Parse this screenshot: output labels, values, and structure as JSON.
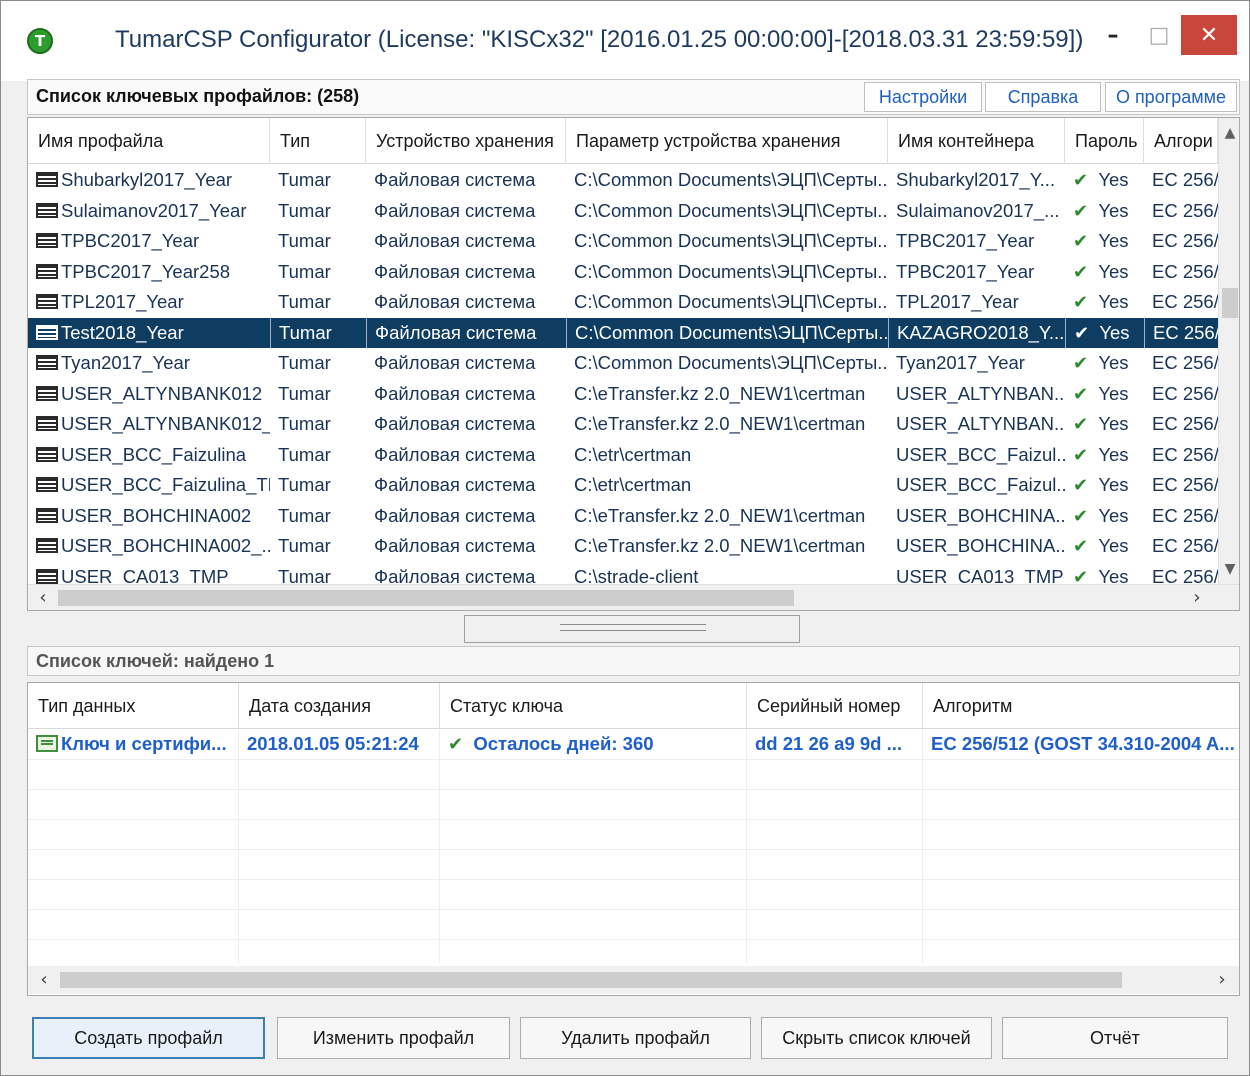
{
  "window": {
    "title": "TumarCSP Configurator (License: \"KISCx32\" [2016.01.25 00:00:00]-[2018.03.31 23:59:59])",
    "app_icon_letter": "T",
    "min_glyph": "–",
    "max_glyph": "□",
    "close_glyph": "✕"
  },
  "profiles": {
    "title": "Список ключевых профайлов: (258)",
    "buttons": {
      "settings": "Настройки",
      "help": "Справка",
      "about": "О программе"
    },
    "columns": [
      "Имя профайла",
      "Тип",
      "Устройство хранения",
      "Параметр устройства хранения",
      "Имя контейнера",
      "Пароль",
      "Алгори"
    ],
    "selected_index": 5,
    "rows": [
      {
        "name": "Shubarkyl2017_Year",
        "type": "Tumar",
        "storage": "Файловая система",
        "param": "C:\\Common Documents\\ЭЦП\\Серты...",
        "container": "Shubarkyl2017_Y...",
        "password": "Yes",
        "algo": "EC 256/"
      },
      {
        "name": "Sulaimanov2017_Year",
        "type": "Tumar",
        "storage": "Файловая система",
        "param": "C:\\Common Documents\\ЭЦП\\Серты...",
        "container": "Sulaimanov2017_...",
        "password": "Yes",
        "algo": "EC 256/"
      },
      {
        "name": "TPBC2017_Year",
        "type": "Tumar",
        "storage": "Файловая система",
        "param": "C:\\Common Documents\\ЭЦП\\Серты...",
        "container": "TPBC2017_Year",
        "password": "Yes",
        "algo": "EC 256/"
      },
      {
        "name": "TPBC2017_Year258",
        "type": "Tumar",
        "storage": "Файловая система",
        "param": "C:\\Common Documents\\ЭЦП\\Серты...",
        "container": "TPBC2017_Year",
        "password": "Yes",
        "algo": "EC 256/"
      },
      {
        "name": "TPL2017_Year",
        "type": "Tumar",
        "storage": "Файловая система",
        "param": "C:\\Common Documents\\ЭЦП\\Серты...",
        "container": "TPL2017_Year",
        "password": "Yes",
        "algo": "EC 256/"
      },
      {
        "name": "Test2018_Year",
        "type": "Tumar",
        "storage": "Файловая система",
        "param": "C:\\Common Documents\\ЭЦП\\Серты...",
        "container": "KAZAGRO2018_Y...",
        "password": "Yes",
        "algo": "EC 256/"
      },
      {
        "name": "Tyan2017_Year",
        "type": "Tumar",
        "storage": "Файловая система",
        "param": "C:\\Common Documents\\ЭЦП\\Серты...",
        "container": "Tyan2017_Year",
        "password": "Yes",
        "algo": "EC 256/"
      },
      {
        "name": "USER_ALTYNBANK012",
        "type": "Tumar",
        "storage": "Файловая система",
        "param": "C:\\eTransfer.kz 2.0_NEW1\\certman",
        "container": "USER_ALTYNBAN...",
        "password": "Yes",
        "algo": "EC 256/"
      },
      {
        "name": "USER_ALTYNBANK012_...",
        "type": "Tumar",
        "storage": "Файловая система",
        "param": "C:\\eTransfer.kz 2.0_NEW1\\certman",
        "container": "USER_ALTYNBAN...",
        "password": "Yes",
        "algo": "EC 256/"
      },
      {
        "name": "USER_BCC_Faizulina",
        "type": "Tumar",
        "storage": "Файловая система",
        "param": "C:\\etr\\certman",
        "container": "USER_BCC_Faizul...",
        "password": "Yes",
        "algo": "EC 256/"
      },
      {
        "name": "USER_BCC_Faizulina_TMP",
        "type": "Tumar",
        "storage": "Файловая система",
        "param": "C:\\etr\\certman",
        "container": "USER_BCC_Faizul...",
        "password": "Yes",
        "algo": "EC 256/"
      },
      {
        "name": "USER_BOHCHINA002",
        "type": "Tumar",
        "storage": "Файловая система",
        "param": "C:\\eTransfer.kz 2.0_NEW1\\certman",
        "container": "USER_BOHCHINA...",
        "password": "Yes",
        "algo": "EC 256/"
      },
      {
        "name": "USER_BOHCHINA002_...",
        "type": "Tumar",
        "storage": "Файловая система",
        "param": "C:\\eTransfer.kz 2.0_NEW1\\certman",
        "container": "USER_BOHCHINA...",
        "password": "Yes",
        "algo": "EC 256/"
      },
      {
        "name": "USER_CA013_TMP",
        "type": "Tumar",
        "storage": "Файловая система",
        "param": "C:\\strade-client",
        "container": "USER_CA013_TMP",
        "password": "Yes",
        "algo": "EC 256/"
      }
    ]
  },
  "keys": {
    "title": "Список ключей: найдено 1",
    "columns": [
      "Тип данных",
      "Дата создания",
      "Статус ключа",
      "Серийный номер",
      "Алгоритм"
    ],
    "rows": [
      {
        "type": "Ключ и сертифи...",
        "date": "2018.01.05 05:21:24",
        "status": "Осталось дней: 360",
        "serial": "dd 21 26 a9 9d ...",
        "algorithm": "EC 256/512 (GOST 34.310-2004 A..."
      }
    ]
  },
  "actions": {
    "create": "Создать профайл",
    "edit": "Изменить профайл",
    "delete": "Удалить профайл",
    "hide_keys": "Скрыть список ключей",
    "report": "Отчёт"
  },
  "glyphs": {
    "check": "✔",
    "scroll_up": "▲",
    "scroll_down": "▼",
    "scroll_left": "‹",
    "scroll_right": "›"
  },
  "colors": {
    "selected_row": "#0f3d62",
    "link_blue": "#1f5fc9",
    "check_green": "#2f8a2f",
    "close_red": "#c9463d"
  }
}
